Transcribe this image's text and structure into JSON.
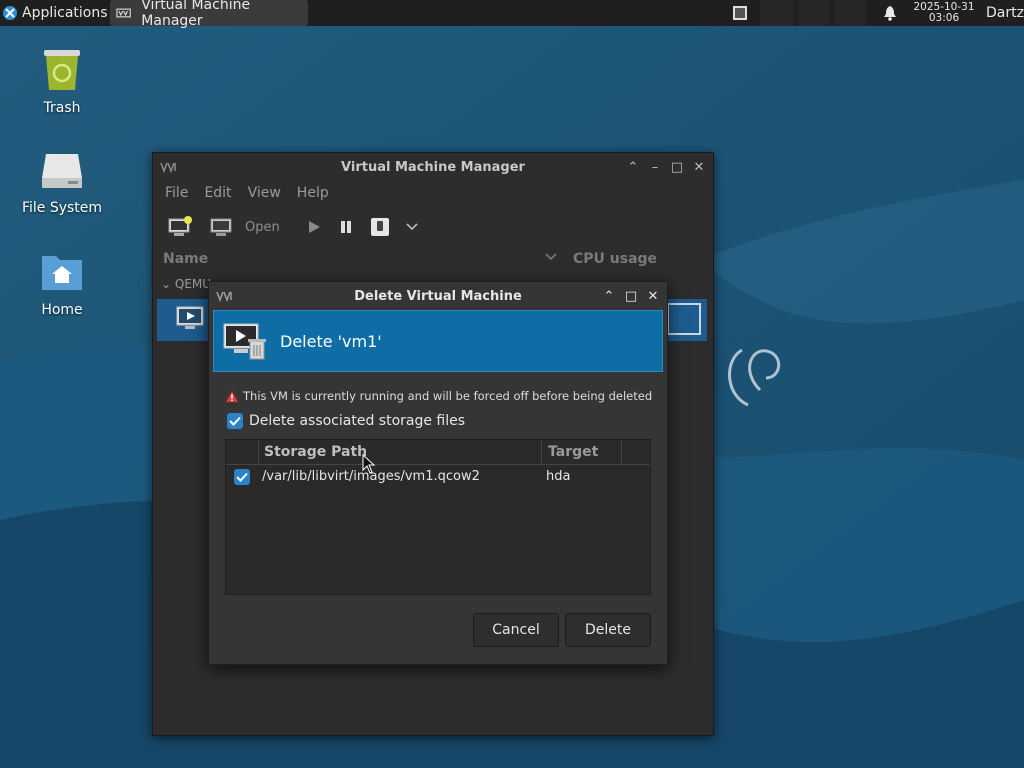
{
  "panel": {
    "apps_label": "Applications",
    "task_label": "Virtual Machine Manager",
    "clock_date": "2025-10-31",
    "clock_time": "03:06",
    "user": "Dartz"
  },
  "desktop": {
    "icons": [
      {
        "label": "Trash",
        "icon": "trash-icon"
      },
      {
        "label": "File System",
        "icon": "drive-icon"
      },
      {
        "label": "Home",
        "icon": "home-folder-icon"
      }
    ]
  },
  "main_window": {
    "title": "Virtual Machine Manager",
    "menu": [
      "File",
      "Edit",
      "View",
      "Help"
    ],
    "toolbar": {
      "open_label": "Open"
    },
    "columns": {
      "name": "Name",
      "cpu": "CPU usage"
    },
    "group": "QEMU"
  },
  "dialog": {
    "title": "Delete Virtual Machine",
    "header": "Delete 'vm1'",
    "warning": "This VM is currently running and will be forced off before being deleted",
    "delete_storage_label": "Delete associated storage files",
    "delete_storage_checked": true,
    "table": {
      "headers": {
        "path": "Storage Path",
        "target": "Target"
      },
      "rows": [
        {
          "checked": true,
          "path": "/var/lib/libvirt/images/vm1.qcow2",
          "target": "hda"
        }
      ]
    },
    "cancel_label": "Cancel",
    "delete_label": "Delete"
  },
  "colors": {
    "accent": "#0f6da6",
    "selection": "#1e5c8f",
    "checkbox": "#2a83c8"
  }
}
